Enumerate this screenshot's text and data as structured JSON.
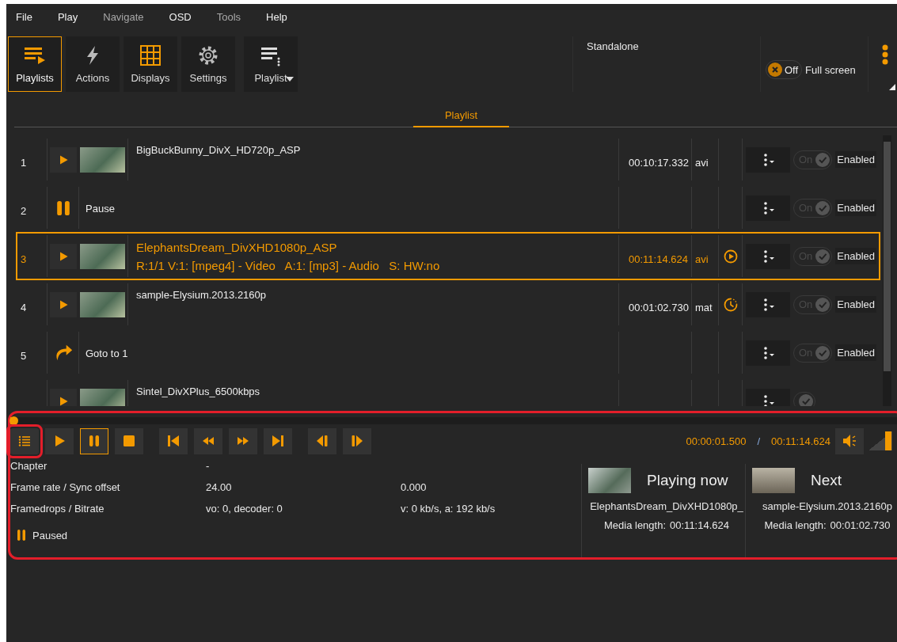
{
  "menu": [
    {
      "label": "File",
      "disabled": false
    },
    {
      "label": "Play",
      "disabled": false
    },
    {
      "label": "Navigate",
      "disabled": true
    },
    {
      "label": "OSD",
      "disabled": false
    },
    {
      "label": "Tools",
      "disabled": true
    },
    {
      "label": "Help",
      "disabled": false
    }
  ],
  "toolbar": [
    {
      "label": "Playlists",
      "kind": "playlists",
      "selected": true,
      "dropdown": false
    },
    {
      "label": "Actions",
      "kind": "actions",
      "selected": false,
      "dropdown": false
    },
    {
      "label": "Displays",
      "kind": "displays",
      "selected": false,
      "dropdown": false
    },
    {
      "label": "Settings",
      "kind": "settings",
      "selected": false,
      "dropdown": false
    },
    {
      "label": "Playlist",
      "kind": "menu",
      "selected": false,
      "dropdown": true
    }
  ],
  "mode_label": "Standalone",
  "fullscreen": {
    "state_label": "Off",
    "on": false,
    "label": "Full screen"
  },
  "tabs": [
    {
      "label": "Playlist",
      "selected": true
    }
  ],
  "playlist": {
    "rows": [
      {
        "number": "1",
        "kind": "media",
        "title": "BigBuckBunny_DivX_HD720p_ASP",
        "duration": "00:10:17.332",
        "ext": "avi",
        "playing": false,
        "scheduled": false,
        "selected": false,
        "toggle_label": "On",
        "enabled": true,
        "enabled_label": "Enabled"
      },
      {
        "number": "2",
        "kind": "pause",
        "title": "Pause",
        "playing": false,
        "scheduled": false,
        "selected": false,
        "toggle_label": "On",
        "enabled": true,
        "enabled_label": "Enabled"
      },
      {
        "number": "3",
        "kind": "media",
        "title": "ElephantsDream_DivXHD1080p_ASP",
        "details": "R:1/1 V:1: [mpeg4] - Video   A:1: [mp3] - Audio   S: HW:no",
        "duration": "00:11:14.624",
        "ext": "avi",
        "playing": true,
        "scheduled": false,
        "selected": true,
        "toggle_label": "On",
        "enabled": true,
        "enabled_label": "Enabled"
      },
      {
        "number": "4",
        "kind": "media",
        "title": "sample-Elysium.2013.2160p",
        "duration": "00:01:02.730",
        "ext": "mat",
        "playing": false,
        "scheduled": true,
        "selected": false,
        "toggle_label": "On",
        "enabled": true,
        "enabled_label": "Enabled"
      },
      {
        "number": "5",
        "kind": "goto",
        "title": "Goto to 1",
        "playing": false,
        "scheduled": false,
        "selected": false,
        "toggle_label": "On",
        "enabled": true,
        "enabled_label": "Enabled"
      },
      {
        "kind": "media",
        "title": "Sintel_DivXPlus_6500kbps",
        "playing": false,
        "scheduled": false,
        "selected": false,
        "enabled": true
      }
    ]
  },
  "player": {
    "highlighted": true,
    "seek": {
      "level": 0.002
    },
    "buttons": [
      {
        "kind": "list",
        "selected": false,
        "highlighted": true
      },
      {
        "kind": "play",
        "selected": false,
        "highlighted": false
      },
      {
        "kind": "pause",
        "selected": true,
        "highlighted": false
      },
      {
        "kind": "stop",
        "selected": false,
        "highlighted": false
      },
      {
        "kind": "prev",
        "selected": false,
        "highlighted": false
      },
      {
        "kind": "rewind",
        "selected": false,
        "highlighted": false
      },
      {
        "kind": "ffwd",
        "selected": false,
        "highlighted": false
      },
      {
        "kind": "next",
        "selected": false,
        "highlighted": false
      },
      {
        "kind": "stepback",
        "selected": false,
        "highlighted": false
      },
      {
        "kind": "stepfwd",
        "selected": false,
        "highlighted": false
      }
    ],
    "position": "00:00:01.500",
    "separator": "/",
    "length": "00:11:14.624",
    "volume": {
      "level": 0.95
    },
    "info": [
      {
        "label": "Chapter",
        "values": [
          "-"
        ]
      },
      {
        "label": "Frame rate / Sync offset",
        "values": [
          "24.00",
          "0.000"
        ]
      },
      {
        "label": "Framedrops / Bitrate",
        "values": [
          "vo: 0, decoder: 0",
          "v: 0 kb/s, a: 192 kb/s"
        ]
      }
    ],
    "state": {
      "kind": "paused",
      "label": "Paused"
    },
    "cards": [
      {
        "heading": "Playing now",
        "title": "ElephantsDream_DivXHD1080p_",
        "length_label": "Media length:",
        "length": "00:11:14.624"
      },
      {
        "heading": "Next",
        "title": "sample-Elysium.2013.2160p",
        "length_label": "Media length:",
        "length": "00:01:02.730"
      }
    ]
  }
}
